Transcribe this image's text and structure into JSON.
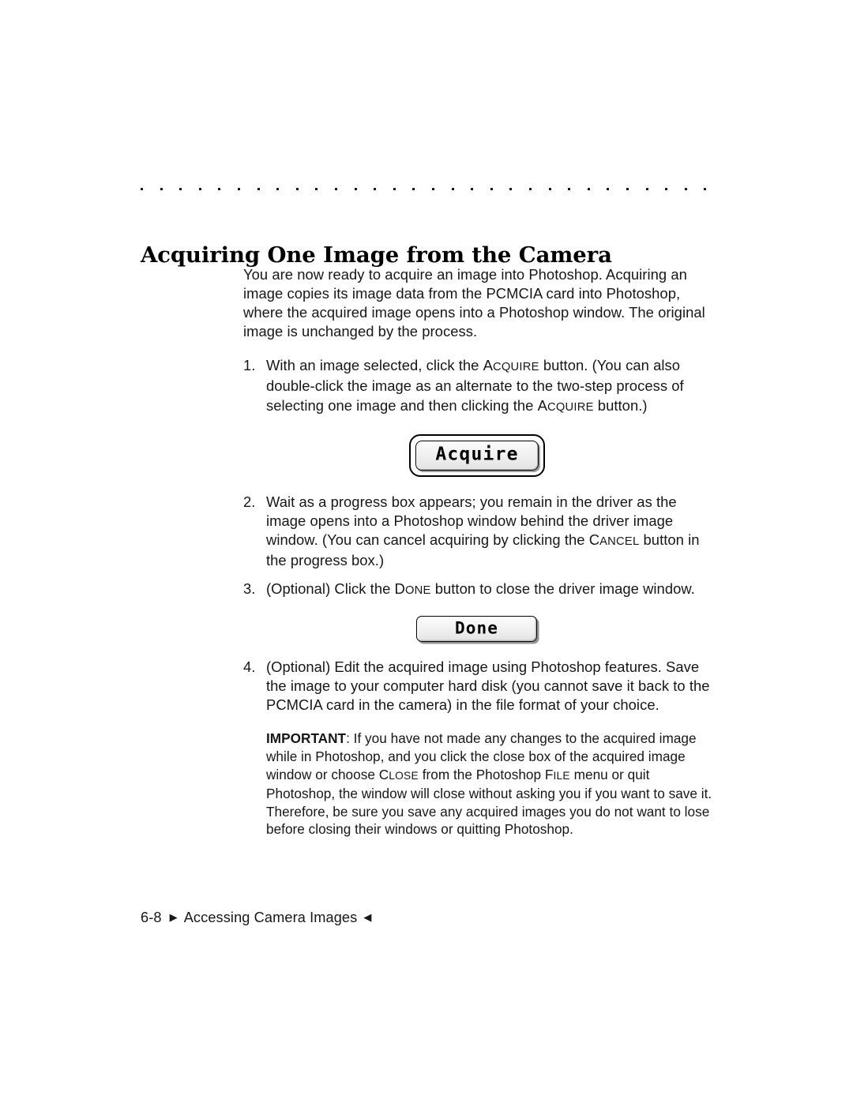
{
  "page": {
    "heading": "Acquiring One Image from the Camera",
    "dot_rule": {
      "count": 30,
      "spacing_px": 24.6,
      "color": "#1a1a1a"
    }
  },
  "intro": {
    "text": "You are now ready to acquire an image into Photoshop. Acquiring an image copies its image data from the PCMCIA card into Photoshop, where the acquired image opens into a Photoshop window. The original image is unchanged by the process."
  },
  "steps": [
    {
      "number": "1.",
      "segments": [
        {
          "type": "text",
          "value": "With an image selected, click the "
        },
        {
          "type": "smallcaps",
          "value": "Acquire"
        },
        {
          "type": "text",
          "value": " button. (You can also double-click the image as an alternate to the two-step process of selecting one image and then clicking the "
        },
        {
          "type": "smallcaps",
          "value": "Acquire"
        },
        {
          "type": "text",
          "value": " button.)"
        }
      ]
    },
    {
      "number": "2.",
      "segments": [
        {
          "type": "text",
          "value": "Wait as a progress box appears; you remain in the driver as the image opens into a Photoshop window behind the driver image window. (You can cancel acquiring by clicking the "
        },
        {
          "type": "smallcaps",
          "value": "Cancel"
        },
        {
          "type": "text",
          "value": " button in the progress box.)"
        }
      ]
    },
    {
      "number": "3.",
      "segments": [
        {
          "type": "text",
          "value": "(Optional) Click the "
        },
        {
          "type": "smallcaps",
          "value": "Done"
        },
        {
          "type": "text",
          "value": " button to close the driver image window."
        }
      ]
    },
    {
      "number": "4.",
      "segments": [
        {
          "type": "text",
          "value": "(Optional) Edit the acquired image using Photoshop features. Save the image to your computer hard disk (you cannot save it back to the PCMCIA card in the camera) in the file format of your choice."
        }
      ]
    }
  ],
  "buttons": {
    "acquire": {
      "label": "Acquire",
      "style": "mac-default"
    },
    "done": {
      "label": "Done",
      "style": "mac-plain"
    }
  },
  "important": {
    "lead": "IMPORTANT",
    "segments": [
      {
        "type": "bold",
        "value": "IMPORTANT"
      },
      {
        "type": "text",
        "value": ": If you have not made any changes to the acquired image while in Photoshop, and you click the close box of the acquired image window or choose "
      },
      {
        "type": "smallcaps",
        "value": "Close"
      },
      {
        "type": "text",
        "value": " from the Photoshop "
      },
      {
        "type": "smallcaps",
        "value": "File"
      },
      {
        "type": "text",
        "value": " menu or quit Photoshop, the window will close without asking you if you want to save it. Therefore, be sure you save any acquired images you do not want to lose before closing their windows or quitting Photoshop."
      }
    ]
  },
  "footer": {
    "folio": "6-8",
    "marker_left": "▶",
    "chapter": "Accessing Camera Images",
    "marker_right": "◀"
  }
}
